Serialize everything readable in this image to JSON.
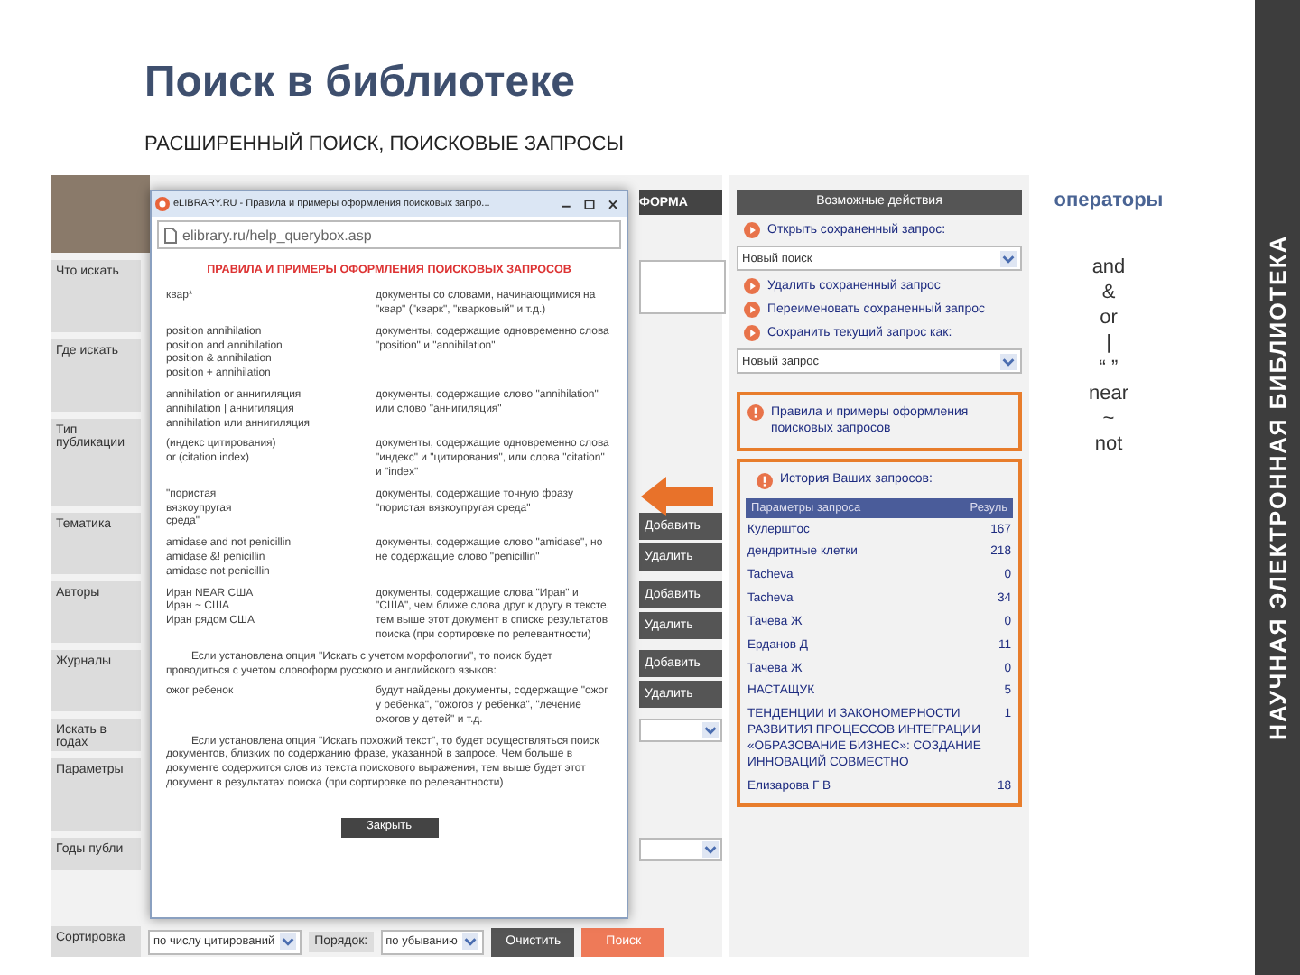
{
  "slide": {
    "title": "Поиск в библиотеке",
    "subtitle": "РАСШИРЕННЫЙ ПОИСК, ПОИСКОВЫЕ ЗАПРОСЫ",
    "side_caption": "НАУЧНАЯ ЭЛЕКТРОННАЯ БИБЛИОТЕКА"
  },
  "search_form": {
    "header": "ФОРМА",
    "rows": [
      {
        "kind": "photo"
      },
      {
        "kind": "text",
        "label": "Что искать"
      },
      {
        "kind": "plain",
        "label": "Где искать"
      },
      {
        "kind": "plain",
        "label": "Тип публикации"
      },
      {
        "kind": "buttons",
        "label": "Тематика",
        "buttons": [
          "Добавить",
          "Удалить"
        ]
      },
      {
        "kind": "buttons",
        "label": "Авторы",
        "buttons": [
          "Добавить",
          "Удалить"
        ]
      },
      {
        "kind": "buttons",
        "label": "Журналы",
        "buttons": [
          "Добавить",
          "Удалить"
        ]
      },
      {
        "kind": "select",
        "label": "Искать в годах"
      },
      {
        "kind": "plain",
        "label": "Параметры"
      },
      {
        "kind": "select",
        "label": "Годы публи"
      }
    ],
    "sort": {
      "label": "Сортировка",
      "sort_by": "по числу цитирований",
      "order_label": "Порядок:",
      "order": "по убыванию"
    },
    "actions": [
      {
        "kind": "secondary",
        "label": "Очистить"
      },
      {
        "kind": "primary",
        "label": "Поиск"
      }
    ]
  },
  "popup": {
    "title": "eLIBRARY.RU - Правила и примеры оформления поисковых запро...",
    "address": "elibrary.ru/help_querybox.asp",
    "heading": "ПРАВИЛА И ПРИМЕРЫ ОФОРМЛЕНИЯ ПОИСКОВЫХ ЗАПРОСОВ",
    "sections": [
      {
        "kind": "rule",
        "query": "квар*",
        "description": "документы со словами, начинающимися на \"квар\" (\"кварк\", \"кварковый\" и т.д.)"
      },
      {
        "kind": "rule",
        "query": "position annihilation\nposition and annihilation\nposition & annihilation\nposition + annihilation",
        "description": "документы, содержащие одновременно слова \"position\" и \"annihilation\""
      },
      {
        "kind": "rule",
        "query": "annihilation or аннигиляция\nannihilation | аннигиляция\nannihilation или аннигиляция",
        "description": "документы, содержащие слово \"annihilation\" или слово \"аннигиляция\""
      },
      {
        "kind": "rule",
        "query": "(индекс цитирования)\nor (citation index)",
        "description": "документы, содержащие одновременно слова \"индекс\" и \"цитирования\", или слова \"citation\" и \"index\""
      },
      {
        "kind": "rule",
        "query": "\"пористая\nвязкоупругая\nсреда\"",
        "description": "документы, содержащие точную фразу \"пористая вязкоупругая среда\""
      },
      {
        "kind": "rule",
        "query": "amidase and not penicillin\namidase &! penicillin\namidase not penicillin",
        "description": "документы, содержащие слово \"amidase\", но не содержащие слово \"penicillin\""
      },
      {
        "kind": "rule",
        "query": "Иран NEAR США\nИран ~ США\nИран рядом США",
        "description": "документы, содержащие слова \"Иран\" и \"США\", чем ближе слова друг к другу в тексте, тем выше этот документ в списке результатов поиска (при сортировке по релевантности)"
      },
      {
        "kind": "note",
        "text": "Если установлена опция \"Искать с учетом морфологии\", то поиск будет проводиться с учетом словоформ русского и английского языков:"
      },
      {
        "kind": "rule",
        "query": "ожог ребенок",
        "description": "будут найдены документы, содержащие \"ожог у ребенка\", \"ожогов у ребенка\", \"лечение ожогов у детей\" и т.д."
      },
      {
        "kind": "note",
        "text": "Если установлена опция \"Искать похожий текст\", то будет осуществляться поиск документов, близких по содержанию фразе, указанной в запросе. Чем больше в документе содержится слов из текста поискового выражения, тем выше будет этот документ в результатах поиска (при сортировке по релевантности)"
      }
    ],
    "close_button": "Закрыть"
  },
  "actions_panel": {
    "header": "Возможные действия",
    "items": [
      {
        "kind": "link",
        "text": "Открыть сохраненный запрос:"
      },
      {
        "kind": "select",
        "text": "Новый поиск"
      },
      {
        "kind": "link",
        "text": "Удалить сохраненный запрос"
      },
      {
        "kind": "link",
        "text": "Переименовать сохраненный запрос"
      },
      {
        "kind": "link",
        "text": "Сохранить текущий запрос как:"
      },
      {
        "kind": "select",
        "text": "Новый запрос"
      }
    ],
    "help_link": "Правила и примеры оформления поисковых запросов",
    "history": {
      "title": "История Ваших запросов:",
      "columns": [
        "Параметры запроса",
        "Резуль"
      ],
      "rows": [
        {
          "query": "Кулерштос",
          "count": "167"
        },
        {
          "query": "дендритные клетки",
          "count": "218"
        },
        {
          "query": "Tacheva",
          "count": "0"
        },
        {
          "query": "Tacheva",
          "count": "34"
        },
        {
          "query": "Тачева Ж",
          "count": "0"
        },
        {
          "query": "Ерданов Д",
          "count": "11"
        },
        {
          "query": "Тачева Ж",
          "count": "0"
        },
        {
          "query": "НАСТАЩУК",
          "count": "5"
        },
        {
          "query": "ТЕНДЕНЦИИ И ЗАКОНОМЕРНОСТИ РАЗВИТИЯ ПРОЦЕССОВ ИНТЕГРАЦИИ «ОБРАЗОВАНИЕ БИЗНЕС»: СОЗДАНИЕ ИННОВАЦИЙ СОВМЕСТНО",
          "count": "1"
        },
        {
          "query": "Елизарова Г В",
          "count": "18"
        }
      ]
    }
  },
  "operators": {
    "title": "операторы",
    "items": [
      "and",
      "&",
      "or",
      "|",
      "“ ”",
      "near",
      "~",
      "not"
    ]
  }
}
